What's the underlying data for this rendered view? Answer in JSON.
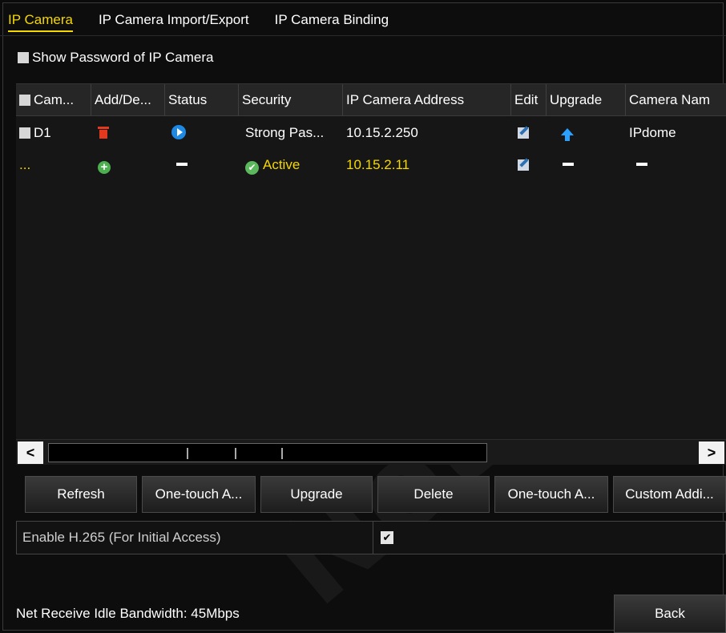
{
  "tabs": [
    {
      "label": "IP Camera",
      "active": true
    },
    {
      "label": "IP Camera Import/Export",
      "active": false
    },
    {
      "label": "IP Camera Binding",
      "active": false
    }
  ],
  "show_password_label": "Show Password of IP Camera",
  "table": {
    "columns": [
      "Cam...",
      "Add/De...",
      "Status",
      "Security",
      "IP Camera Address",
      "Edit",
      "Upgrade",
      "Camera Nam"
    ],
    "rows": [
      {
        "camera": "D1",
        "add_delete_icon": "trash-icon",
        "status_icon": "play-icon",
        "security": "Strong Pas...",
        "ip_address": "10.15.2.250",
        "edit_icon": "edit-icon",
        "upgrade_icon": "upgrade-arrow-icon",
        "camera_name": "IPdome"
      },
      {
        "camera": "...",
        "add_delete_icon": "add-icon",
        "status": "—",
        "security": "Active",
        "ip_address": "10.15.2.11",
        "edit_icon": "edit-icon",
        "upgrade": "—",
        "camera_name": "—"
      }
    ]
  },
  "scrollbar": {
    "left_arrow": "<",
    "right_arrow": ">"
  },
  "buttons": {
    "refresh": "Refresh",
    "one_touch_1": "One-touch A...",
    "upgrade": "Upgrade",
    "delete": "Delete",
    "one_touch_2": "One-touch A...",
    "custom_add": "Custom Addi..."
  },
  "h265": {
    "label": "Enable H.265 (For Initial Access)",
    "checked": true,
    "check_glyph": "✔"
  },
  "bandwidth": "Net Receive Idle Bandwidth: 45Mbps",
  "back": "Back",
  "watermark": "Net",
  "colors": {
    "accent": "#f5d800",
    "background": "#0b0b0b",
    "watermark": "#b40a0a"
  }
}
